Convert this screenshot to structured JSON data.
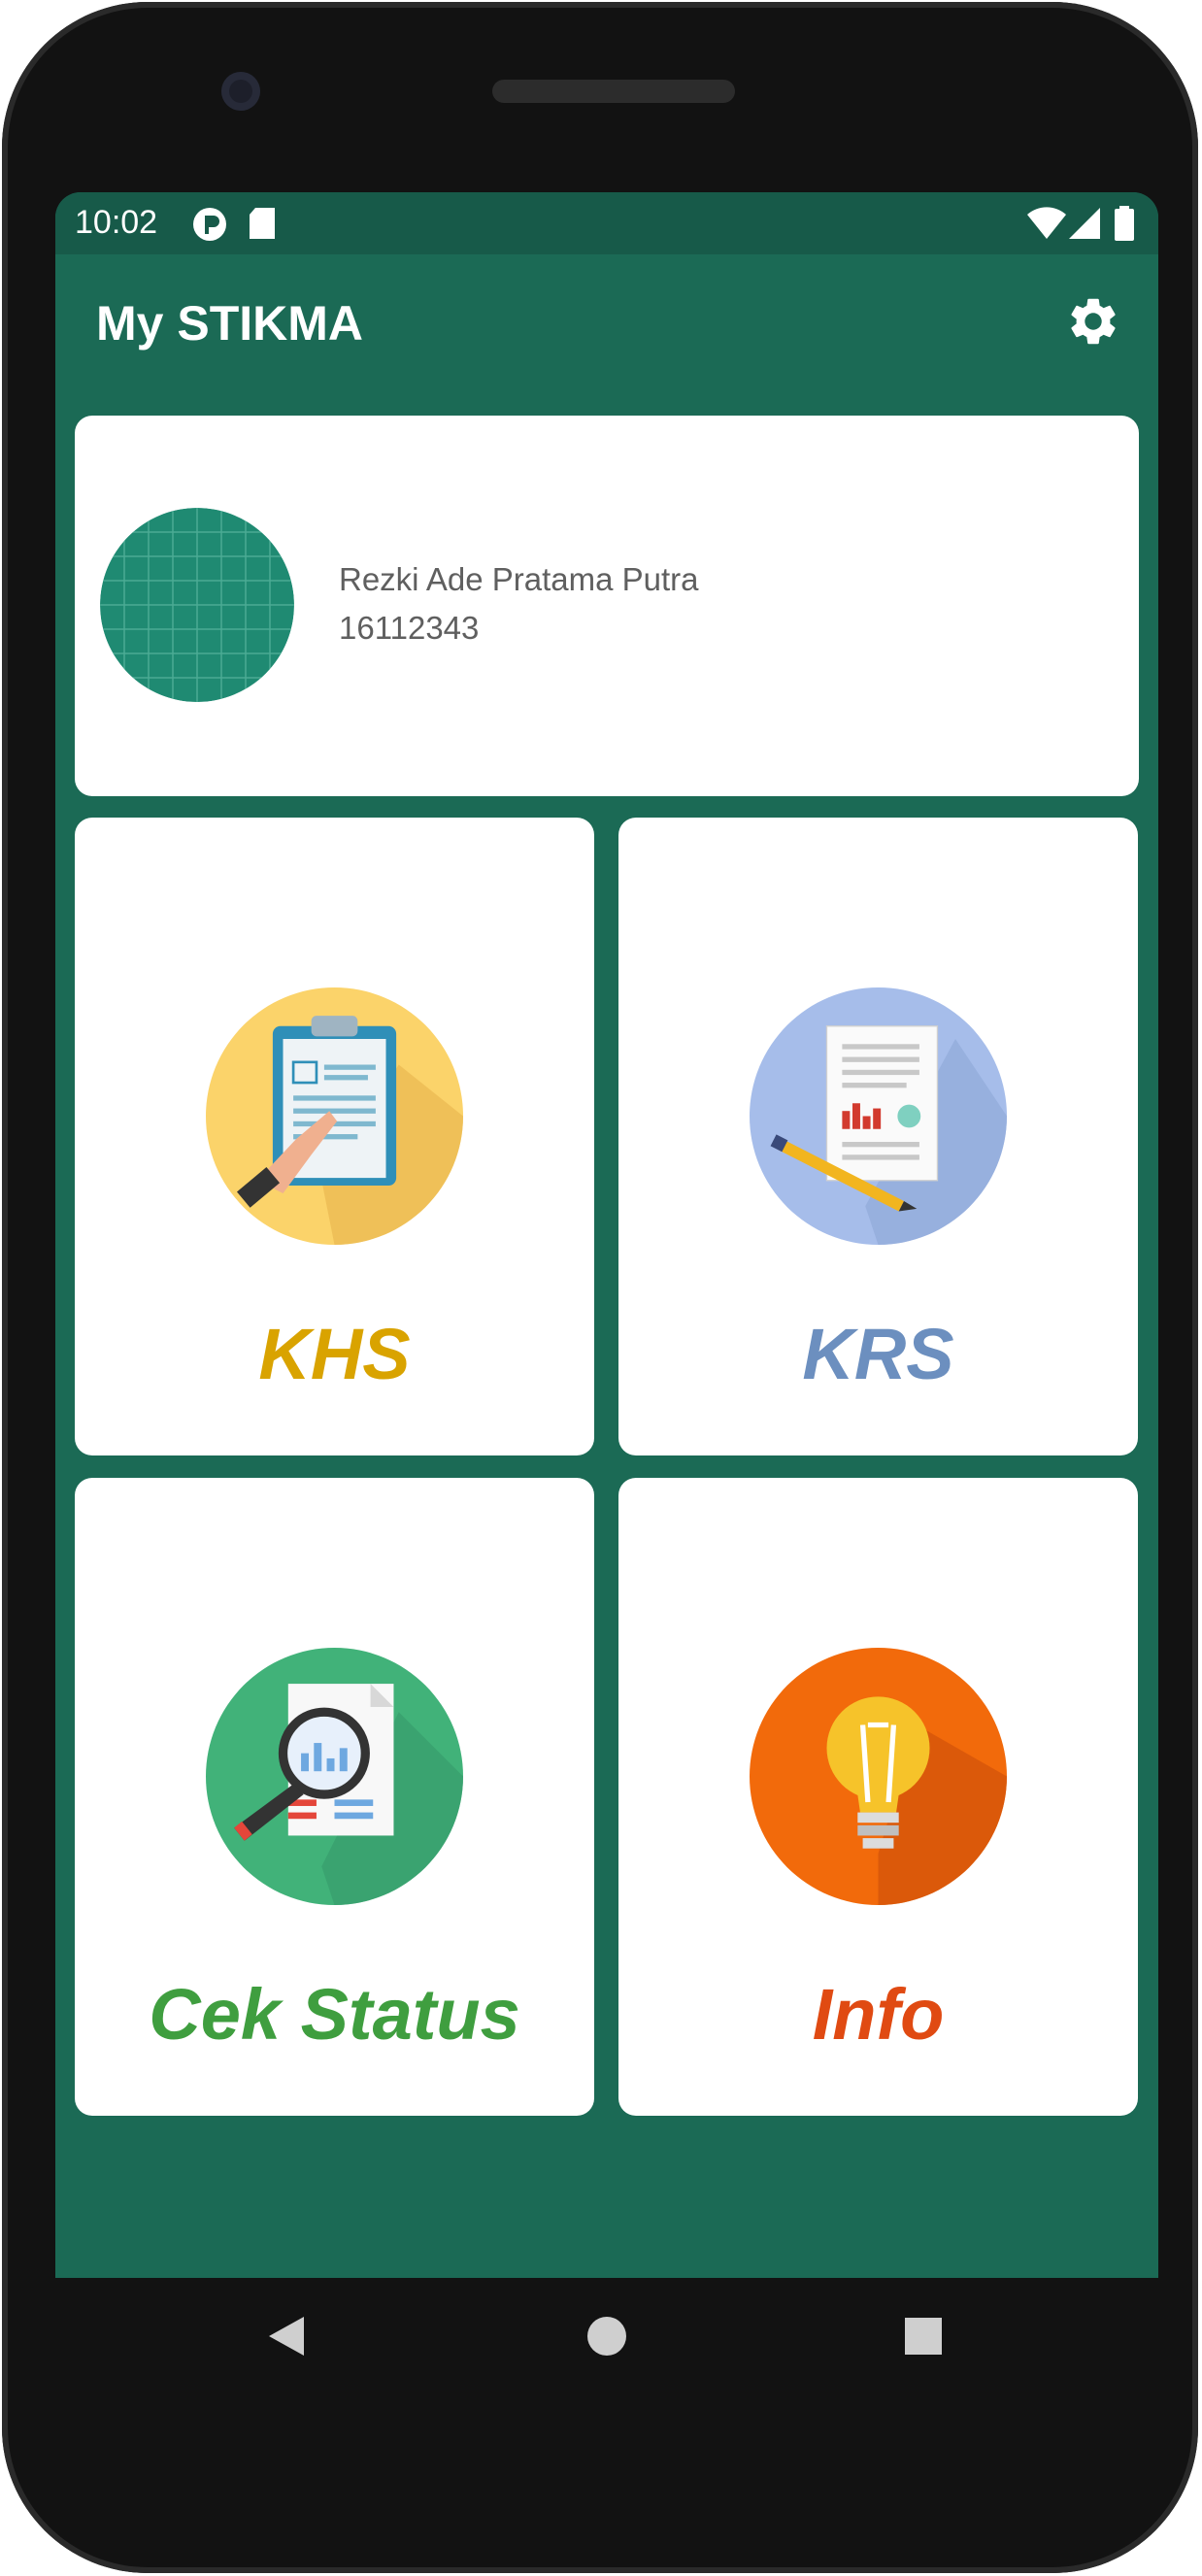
{
  "status_bar": {
    "time": "10:02",
    "icons": [
      "app-notification-icon",
      "sd-card-icon",
      "wifi-icon",
      "signal-icon",
      "battery-icon"
    ]
  },
  "app_bar": {
    "title": "My STIKMA",
    "settings_icon": "gear-icon"
  },
  "profile": {
    "name": "Rezki Ade Pratama Putra",
    "student_id": "16112343"
  },
  "menu": [
    {
      "label": "KHS",
      "icon": "clipboard-icon",
      "color": "#d9a300",
      "icon_bg": "#fbd36a"
    },
    {
      "label": "KRS",
      "icon": "document-chart-icon",
      "color": "#6c8fbf",
      "icon_bg": "#a6bdea"
    },
    {
      "label": "Cek Status",
      "icon": "magnifier-report-icon",
      "color": "#3f9e3f",
      "icon_bg": "#41b279"
    },
    {
      "label": "Info",
      "icon": "lightbulb-icon",
      "color": "#e04a12",
      "icon_bg": "#f26a0b"
    }
  ],
  "navigation": [
    "back-icon",
    "home-icon",
    "recents-icon"
  ],
  "colors": {
    "primary": "#1b6a55",
    "primary_dark": "#175a49"
  }
}
